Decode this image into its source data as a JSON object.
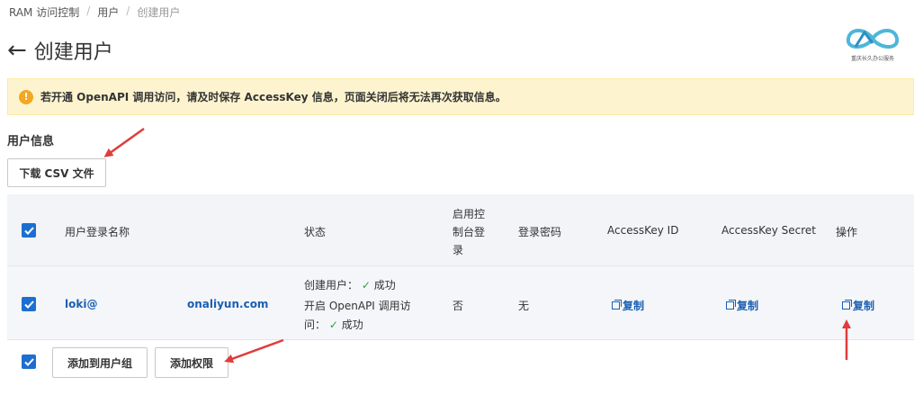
{
  "breadcrumb": {
    "items": [
      "RAM 访问控制",
      "用户",
      "创建用户"
    ]
  },
  "header": {
    "title": "创建用户",
    "back_glyph": "←"
  },
  "logo": {
    "caption": "重庆长久办公服务"
  },
  "alert": {
    "icon": "!",
    "message": "若开通 OpenAPI 调用访问，请及时保存 AccessKey 信息，页面关闭后将无法再次获取信息。"
  },
  "section": {
    "title": "用户信息",
    "download_csv_label": "下载 CSV 文件"
  },
  "table": {
    "columns": {
      "login_name": "用户登录名称",
      "status": "状态",
      "console_login_l1": "启用控",
      "console_login_l2": "制台登",
      "console_login_l3": "录",
      "password": "登录密码",
      "ak_id": "AccessKey ID",
      "ak_secret": "AccessKey Secret",
      "actions": "操作"
    },
    "rows": [
      {
        "login_prefix": "loki@",
        "login_domain": "onaliyun.com",
        "status_create_label": "创建用户：",
        "status_create_result": "成功",
        "status_api_label_l1": "开启 OpenAPI 调用访",
        "status_api_label_l2": "问：",
        "status_api_result": "成功",
        "console_login": "否",
        "password": "无",
        "ak_id_action": "复制",
        "ak_secret_action": "复制",
        "row_action": "复制"
      }
    ]
  },
  "footer": {
    "add_to_group_label": "添加到用户组",
    "add_permission_label": "添加权限"
  },
  "colors": {
    "accent": "#1c6fd1",
    "link": "#1a5fb4",
    "success": "#2aa347",
    "warning_bg": "#fdf4cf",
    "annotation_arrow": "#e03c3c"
  }
}
